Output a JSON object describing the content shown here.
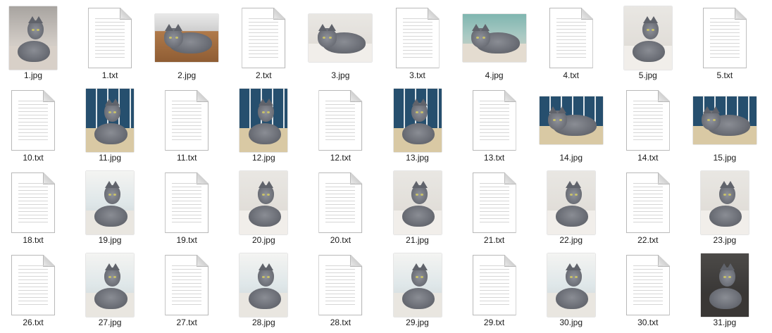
{
  "colors": {
    "background": "#ffffff",
    "label_text": "#1a1a1a"
  },
  "files": [
    {
      "name": "1.jpg",
      "type": "image",
      "orientation": "portrait",
      "scene": "couch"
    },
    {
      "name": "1.txt",
      "type": "text"
    },
    {
      "name": "2.jpg",
      "type": "image",
      "orientation": "landscape",
      "scene": "wood"
    },
    {
      "name": "2.txt",
      "type": "text"
    },
    {
      "name": "3.jpg",
      "type": "image",
      "orientation": "landscape",
      "scene": "bed"
    },
    {
      "name": "3.txt",
      "type": "text"
    },
    {
      "name": "4.jpg",
      "type": "image",
      "orientation": "landscape",
      "scene": "teal"
    },
    {
      "name": "4.txt",
      "type": "text"
    },
    {
      "name": "5.jpg",
      "type": "image",
      "orientation": "portrait",
      "scene": "bed"
    },
    {
      "name": "5.txt",
      "type": "text"
    },
    {
      "name": "10.txt",
      "type": "text"
    },
    {
      "name": "11.jpg",
      "type": "image",
      "orientation": "portrait",
      "scene": "blue"
    },
    {
      "name": "11.txt",
      "type": "text"
    },
    {
      "name": "12.jpg",
      "type": "image",
      "orientation": "portrait",
      "scene": "blue"
    },
    {
      "name": "12.txt",
      "type": "text"
    },
    {
      "name": "13.jpg",
      "type": "image",
      "orientation": "portrait",
      "scene": "blue"
    },
    {
      "name": "13.txt",
      "type": "text"
    },
    {
      "name": "14.jpg",
      "type": "image",
      "orientation": "landscape",
      "scene": "blue"
    },
    {
      "name": "14.txt",
      "type": "text"
    },
    {
      "name": "15.jpg",
      "type": "image",
      "orientation": "landscape",
      "scene": "blue"
    },
    {
      "name": "18.txt",
      "type": "text"
    },
    {
      "name": "19.jpg",
      "type": "image",
      "orientation": "portrait",
      "scene": "window"
    },
    {
      "name": "19.txt",
      "type": "text"
    },
    {
      "name": "20.jpg",
      "type": "image",
      "orientation": "portrait",
      "scene": "bed"
    },
    {
      "name": "20.txt",
      "type": "text"
    },
    {
      "name": "21.jpg",
      "type": "image",
      "orientation": "portrait",
      "scene": "bed"
    },
    {
      "name": "21.txt",
      "type": "text"
    },
    {
      "name": "22.jpg",
      "type": "image",
      "orientation": "portrait",
      "scene": "bed"
    },
    {
      "name": "22.txt",
      "type": "text"
    },
    {
      "name": "23.jpg",
      "type": "image",
      "orientation": "portrait",
      "scene": "bed"
    },
    {
      "name": "26.txt",
      "type": "text"
    },
    {
      "name": "27.jpg",
      "type": "image",
      "orientation": "portrait",
      "scene": "window"
    },
    {
      "name": "27.txt",
      "type": "text"
    },
    {
      "name": "28.jpg",
      "type": "image",
      "orientation": "portrait",
      "scene": "window"
    },
    {
      "name": "28.txt",
      "type": "text"
    },
    {
      "name": "29.jpg",
      "type": "image",
      "orientation": "portrait",
      "scene": "window"
    },
    {
      "name": "29.txt",
      "type": "text"
    },
    {
      "name": "30.jpg",
      "type": "image",
      "orientation": "portrait",
      "scene": "window"
    },
    {
      "name": "30.txt",
      "type": "text"
    },
    {
      "name": "31.jpg",
      "type": "image",
      "orientation": "portrait",
      "scene": "dark"
    }
  ]
}
